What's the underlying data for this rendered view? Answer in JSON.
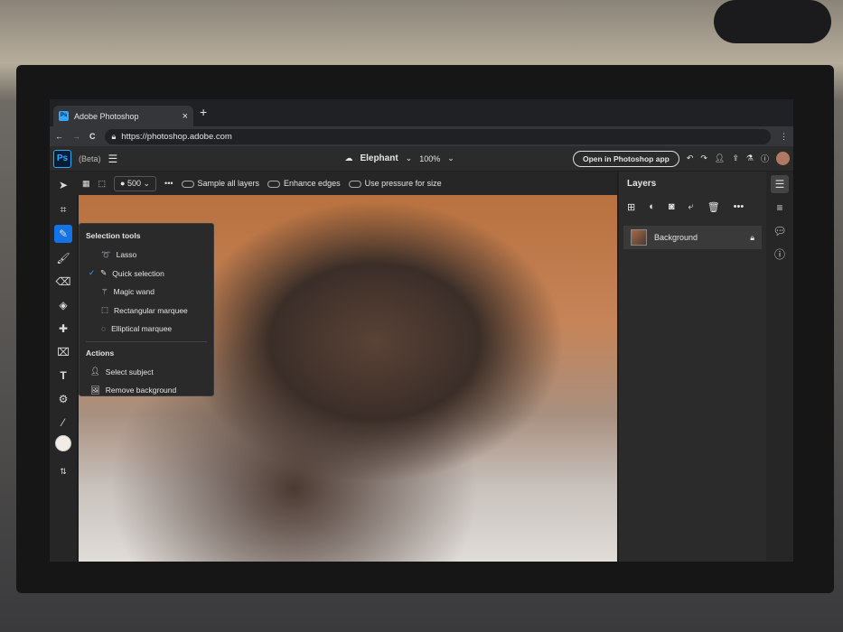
{
  "browser": {
    "tab_title": "Adobe Photoshop",
    "new_tab": "+",
    "close": "×",
    "url": "https://photoshop.adobe.com",
    "back": "←",
    "forward": "→",
    "reload": "C",
    "menu": "⋮"
  },
  "app": {
    "logo": "Ps",
    "beta": "(Beta)",
    "doc_name": "Elephant",
    "zoom": "100%",
    "open_in_app": "Open in Photoshop app"
  },
  "options": {
    "brush_size": "500",
    "more": "•••",
    "sample_all_layers": "Sample all layers",
    "enhance_edges": "Enhance edges",
    "use_pressure": "Use pressure for size"
  },
  "menu": {
    "section1": "Selection tools",
    "items": [
      "Lasso",
      "Quick selection",
      "Magic wand",
      "Rectangular marquee",
      "Elliptical marquee"
    ],
    "checked_index": 1,
    "section2": "Actions",
    "actions": [
      "Select subject",
      "Remove background"
    ]
  },
  "layers": {
    "title": "Layers",
    "items": [
      {
        "name": "Background",
        "locked": true
      }
    ]
  },
  "colors": {
    "accent": "#31a8ff",
    "panel": "#2b2b2b"
  }
}
